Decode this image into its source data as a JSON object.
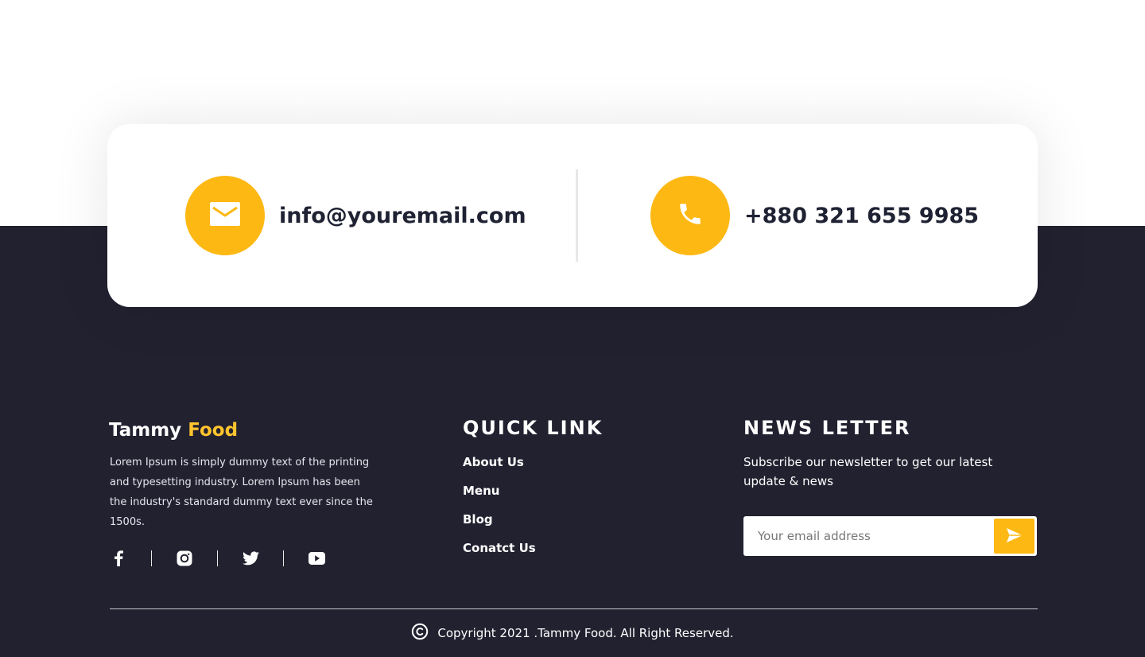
{
  "contact": {
    "email": "info@youremail.com",
    "phone": "+880 321 655 9985"
  },
  "brand": {
    "name_part1": "Tammy",
    "name_part2": "Food",
    "description": "Lorem Ipsum is simply dummy text of the printing and typesetting industry. Lorem Ipsum has been the industry's standard dummy text ever since the 1500s."
  },
  "socials": [
    "facebook-icon",
    "instagram-icon",
    "twitter-icon",
    "youtube-icon"
  ],
  "quick_links": {
    "title": "QUICK LINK",
    "items": [
      "About Us",
      "Menu",
      "Blog",
      "Conatct Us"
    ]
  },
  "newsletter": {
    "title": "NEWS LETTER",
    "text": "Subscribe our newsletter to get our latest update & news",
    "placeholder": "Your email address"
  },
  "copyright": "Copyright 2021 .Tammy Food. All Right Reserved.",
  "colors": {
    "accent": "#FDB813",
    "footer_bg": "#222130",
    "brand_accent": "#FFC42E"
  }
}
